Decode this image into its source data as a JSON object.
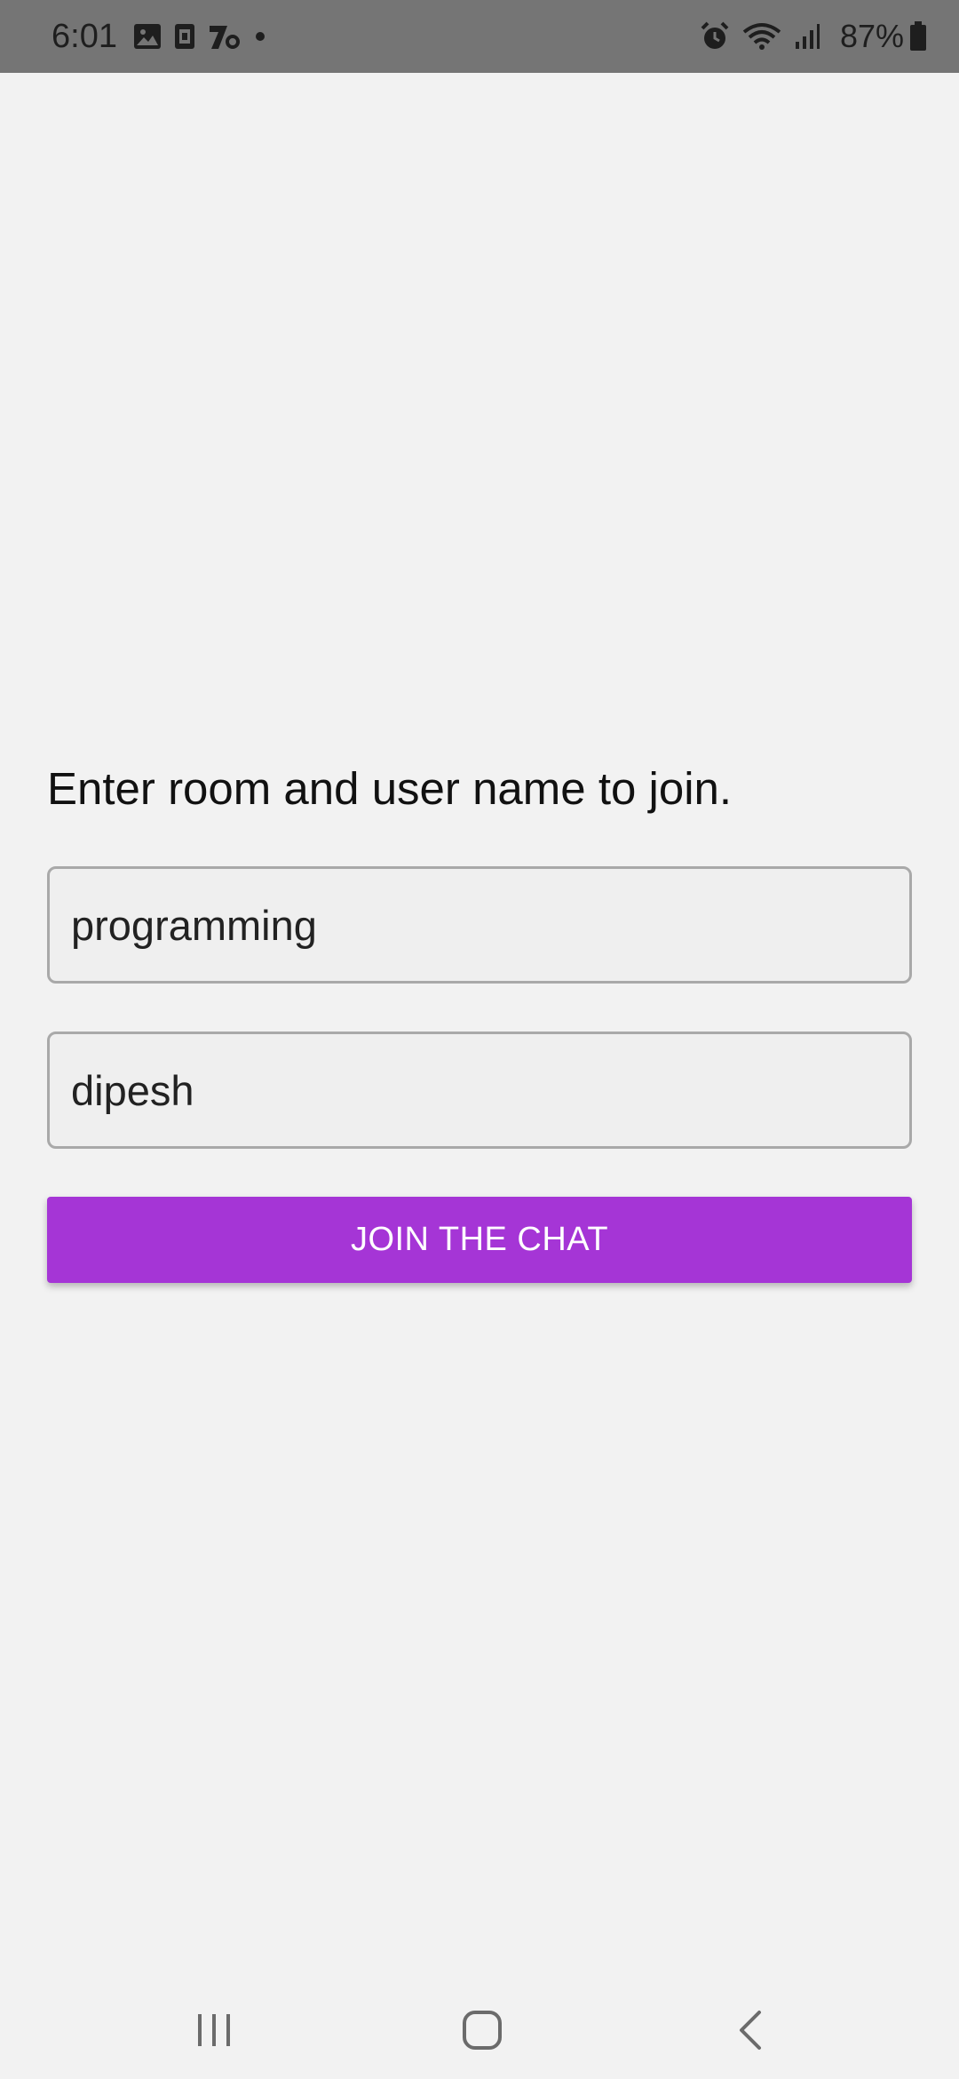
{
  "status_bar": {
    "time": "6:01",
    "battery": "87%",
    "left_icons": [
      "gallery-icon",
      "sim-card-icon",
      "app-notification-icon",
      "dot-icon"
    ],
    "right_icons": [
      "alarm-icon",
      "wifi-icon",
      "signal-icon",
      "battery-icon"
    ]
  },
  "form": {
    "prompt": "Enter room and user name to join.",
    "room_value": "programming",
    "user_value": "dipesh",
    "join_label": "JOIN THE CHAT"
  },
  "colors": {
    "accent": "#a535d6",
    "background": "#f2f2f2",
    "status_bar": "#757575"
  },
  "nav_bar": {
    "buttons": [
      "recents-icon",
      "home-icon",
      "back-icon"
    ]
  }
}
